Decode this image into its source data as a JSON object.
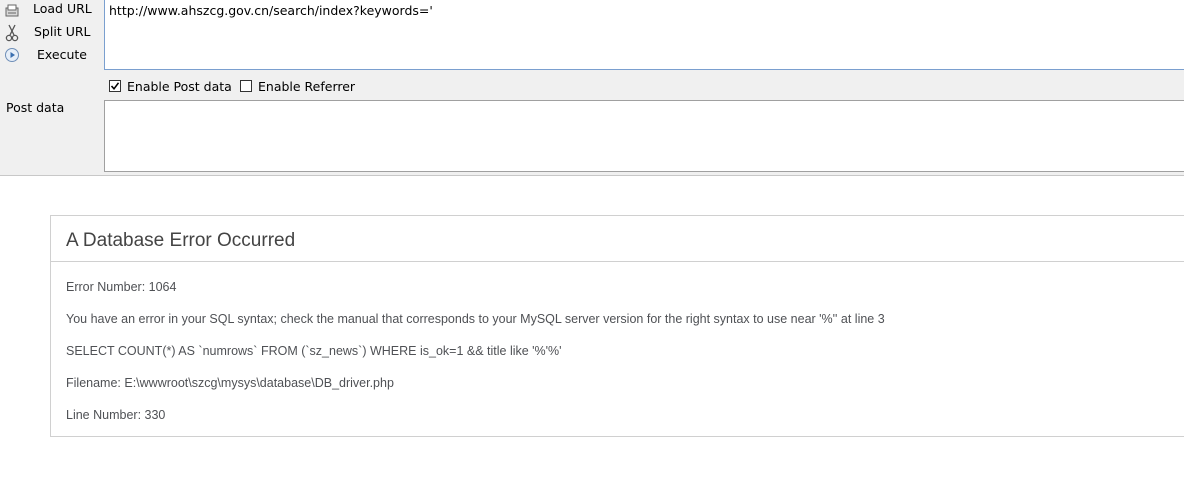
{
  "toolbar": {
    "load_url": "Load URL",
    "split_url": "Split URL",
    "execute": "Execute",
    "load_url_icon": "document-load-icon",
    "split_url_icon": "scissors-icon",
    "execute_icon": "play-circle-icon"
  },
  "url_field": {
    "value": "http://www.ahszcg.gov.cn/search/index?keywords='"
  },
  "options": {
    "enable_post_data": {
      "label": "Enable Post data",
      "checked": true
    },
    "enable_referrer": {
      "label": "Enable Referrer",
      "checked": false
    }
  },
  "post_data": {
    "label": "Post data",
    "value": ""
  },
  "error": {
    "title": "A Database Error Occurred",
    "error_number": "Error Number: 1064",
    "message": "You have an error in your SQL syntax; check the manual that corresponds to your MySQL server version for the right syntax to use near '%'' at line 3",
    "query": "SELECT COUNT(*) AS `numrows` FROM (`sz_news`) WHERE is_ok=1 && title like '%'%'",
    "filename": "Filename: E:\\wwwroot\\szcg\\mysys\\database\\DB_driver.php",
    "line_number": "Line Number: 330"
  },
  "colors": {
    "panel_bg": "#f0f0f0",
    "url_border": "#7a9fcf",
    "error_text": "#4f5155",
    "error_title": "#444444"
  }
}
